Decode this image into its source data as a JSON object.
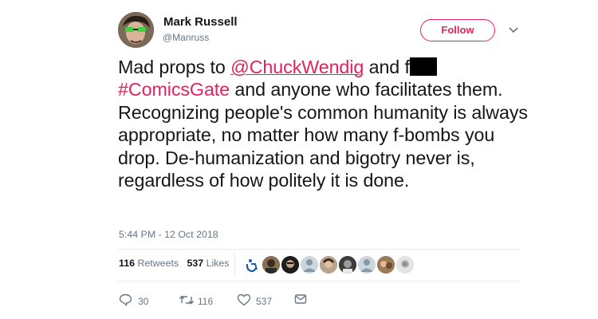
{
  "user": {
    "name": "Mark Russell",
    "handle": "@Manruss",
    "follow_label": "Follow"
  },
  "tweet": {
    "part1": "Mad props to ",
    "mention": "@ChuckWendig",
    "part2": " and f",
    "hashtag": "#ComicsGate",
    "part3": " and anyone who facilitates them. Recognizing people's common humanity is always appropriate, no matter how many f-bombs you drop. De-humanization and bigotry never is, regardless of how politely it is done.",
    "timestamp": "5:44 PM - 12 Oct 2018"
  },
  "stats": {
    "retweets_count": "116",
    "retweets_label": "Retweets",
    "likes_count": "537",
    "likes_label": "Likes"
  },
  "actions": {
    "reply_count": "30",
    "retweet_count": "116",
    "like_count": "537"
  },
  "colors": {
    "accent": "#e0245e",
    "secondary_text": "#657786",
    "divider": "#e6ecf0"
  }
}
